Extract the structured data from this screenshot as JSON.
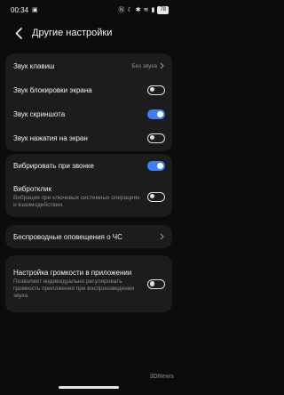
{
  "status_bar": {
    "time": "00:34",
    "battery": "78"
  },
  "header": {
    "title": "Другие настройки"
  },
  "groups": [
    {
      "items": [
        {
          "label": "Звук клавиш",
          "value": "Без звука",
          "type": "link"
        },
        {
          "label": "Звук блокировки экрана",
          "type": "toggle",
          "on": false
        },
        {
          "label": "Звук скриншота",
          "type": "toggle",
          "on": true
        },
        {
          "label": "Звук нажатия на экран",
          "type": "toggle",
          "on": false
        }
      ]
    },
    {
      "items": [
        {
          "label": "Вибрировать при звонке",
          "type": "toggle",
          "on": true
        },
        {
          "label": "Вибротклик",
          "description": "Вибрация при ключевых системных операциях и взаимодействии.",
          "type": "toggle",
          "on": false
        }
      ]
    },
    {
      "items": [
        {
          "label": "Беспроводные оповещения о ЧС",
          "type": "link"
        }
      ]
    },
    {
      "items": [
        {
          "label": "Настройка громкости в приложении",
          "description": "Позволяет индивидуально регулировать громкость приложения при воспроизведении звука.",
          "type": "toggle",
          "on": false
        }
      ]
    }
  ],
  "watermark": "3DNews"
}
